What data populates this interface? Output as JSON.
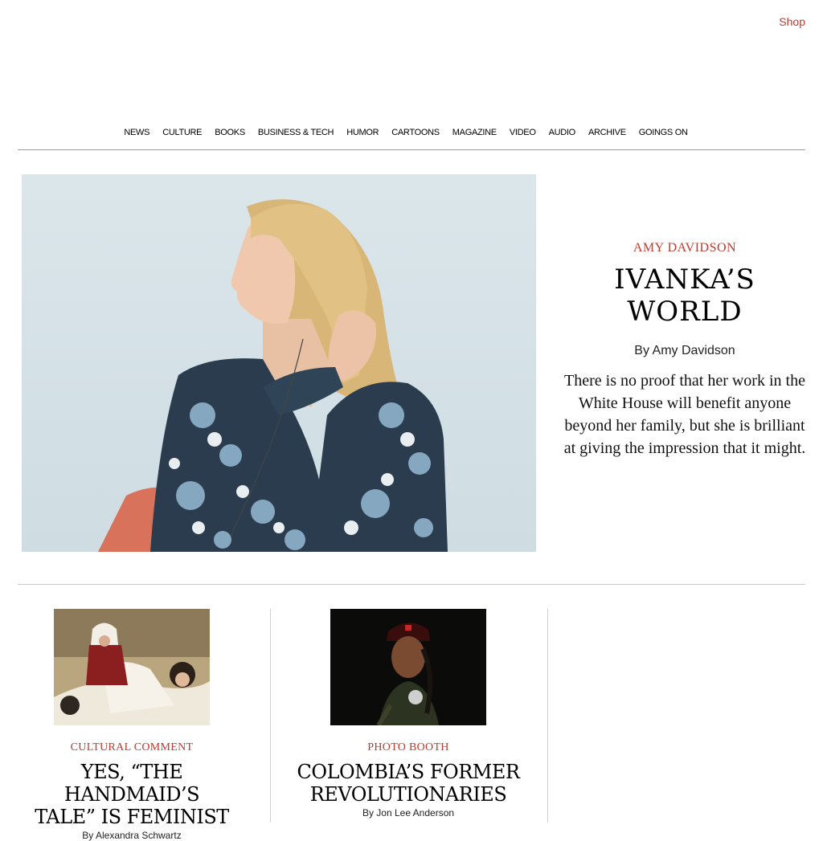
{
  "header": {
    "shop_label": "Shop"
  },
  "nav": {
    "items": [
      "NEWS",
      "CULTURE",
      "BOOKS",
      "BUSINESS & TECH",
      "HUMOR",
      "CARTOONS",
      "MAGAZINE",
      "VIDEO",
      "AUDIO",
      "ARCHIVE",
      "GOINGS ON"
    ]
  },
  "hero": {
    "rubric": "AMY DAVIDSON",
    "title_line1": "IVANKA’S",
    "title_line2": "WORLD",
    "byline": "By Amy Davidson",
    "dek": "There is no proof that her work in the White House will benefit anyone beyond her family, but she is brilliant at giving the impression that it might."
  },
  "cards": [
    {
      "rubric": "CULTURAL COMMENT",
      "title_line1": "YES, “THE HANDMAID’S",
      "title_line2": "TALE” IS FEMINIST",
      "byline": "By Alexandra Schwartz"
    },
    {
      "rubric": "PHOTO BOOTH",
      "title_line1": "COLOMBIA’S FORMER",
      "title_line2": "REVOLUTIONARIES",
      "byline": "By Jon Lee Anderson"
    }
  ],
  "colors": {
    "accent": "#c0392b",
    "rule": "#9a9a9a"
  }
}
